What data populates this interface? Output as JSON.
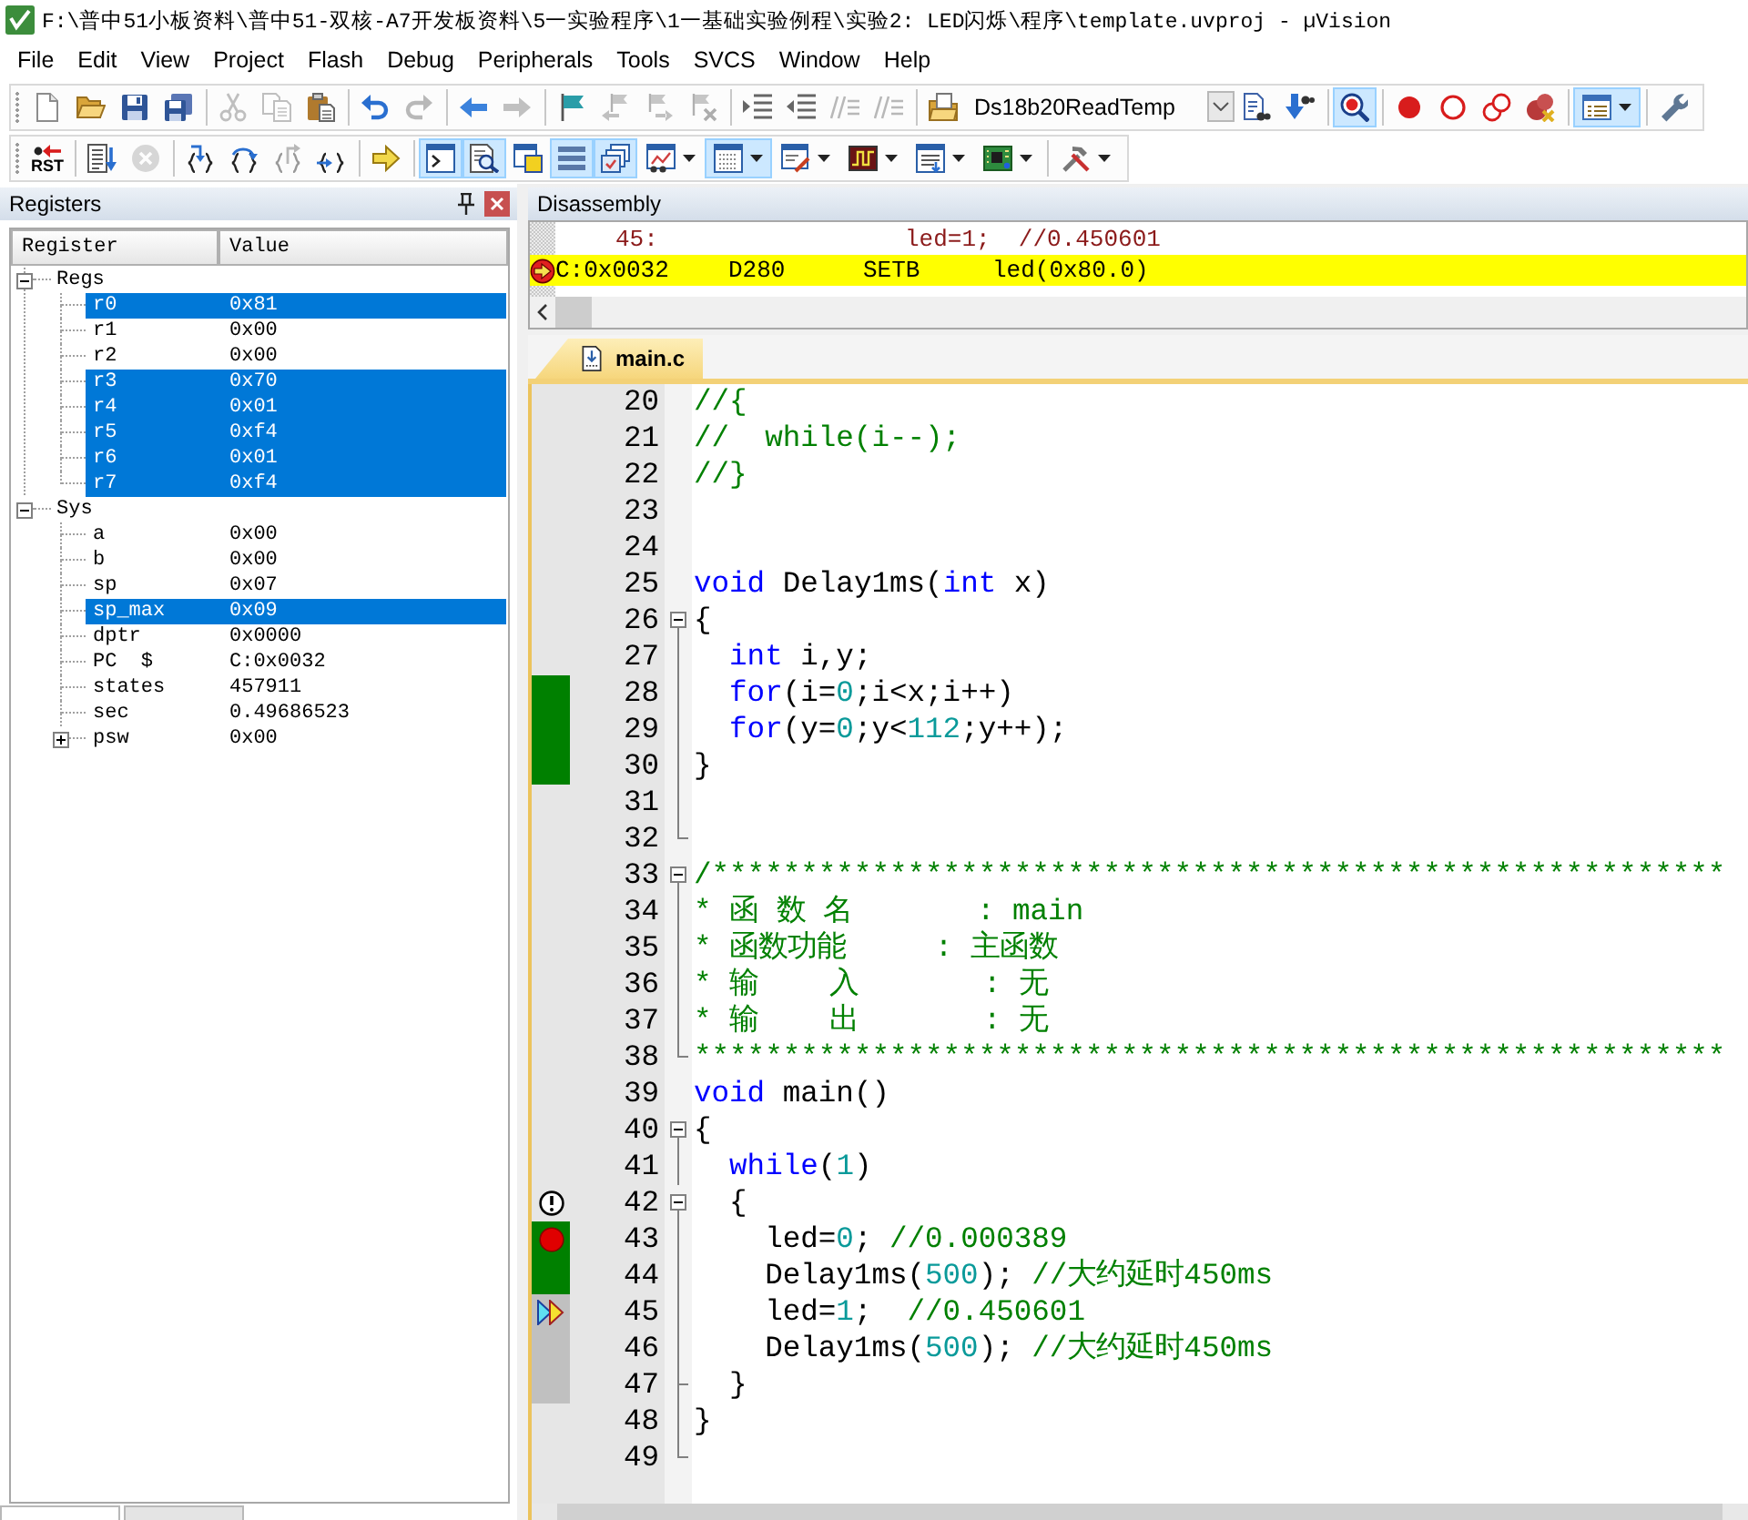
{
  "window": {
    "title": "F:\\普中51小板资料\\普中51-双核-A7开发板资料\\5一实验程序\\1一基础实验例程\\实验2: LED闪烁\\程序\\template.uvproj - µVision"
  },
  "menu": [
    "File",
    "Edit",
    "View",
    "Project",
    "Flash",
    "Debug",
    "Peripherals",
    "Tools",
    "SVCS",
    "Window",
    "Help"
  ],
  "toolbar_1": {
    "buttons": [
      {
        "pressed": false,
        "disabled": false
      },
      {
        "pressed": false,
        "disabled": false
      },
      {
        "pressed": false,
        "disabled": false
      },
      {
        "pressed": false,
        "disabled": false
      },
      {
        "pressed": false,
        "disabled": true
      },
      {
        "pressed": false,
        "disabled": true
      },
      {
        "pressed": false,
        "disabled": false
      },
      {
        "pressed": false,
        "disabled": false
      },
      {
        "pressed": false,
        "disabled": true
      },
      {
        "pressed": false,
        "disabled": false
      },
      {
        "pressed": false,
        "disabled": true
      },
      {
        "pressed": false,
        "disabled": false
      },
      {
        "pressed": false,
        "disabled": true
      },
      {
        "pressed": false,
        "disabled": true
      },
      {
        "pressed": false,
        "disabled": true
      },
      {
        "pressed": false,
        "disabled": false
      },
      {
        "pressed": false,
        "disabled": false
      },
      {
        "pressed": false,
        "disabled": true
      },
      {
        "pressed": false,
        "disabled": true
      },
      {
        "pressed": false,
        "disabled": false
      },
      {
        "pressed": false,
        "disabled": false
      },
      {
        "pressed": false,
        "disabled": false
      },
      {
        "pressed": true,
        "disabled": false
      },
      {
        "pressed": false,
        "disabled": false
      },
      {
        "pressed": false,
        "disabled": false
      },
      {
        "pressed": false,
        "disabled": false
      },
      {
        "pressed": false,
        "disabled": false
      },
      {
        "pressed": true,
        "disabled": false
      },
      {
        "pressed": false,
        "disabled": false
      }
    ],
    "target": {
      "value": "Ds18b20ReadTemp"
    }
  },
  "toolbar_2": {
    "buttons": [
      {
        "label": "RST",
        "pressed": false,
        "disabled": false
      },
      {
        "pressed": false,
        "disabled": false
      },
      {
        "pressed": false,
        "disabled": true
      },
      {
        "pressed": false,
        "disabled": false
      },
      {
        "pressed": false,
        "disabled": false
      },
      {
        "pressed": false,
        "disabled": true
      },
      {
        "pressed": false,
        "disabled": false
      },
      {
        "pressed": false,
        "disabled": false
      },
      {
        "pressed": true,
        "disabled": false
      },
      {
        "pressed": true,
        "disabled": false
      },
      {
        "pressed": false,
        "disabled": false
      },
      {
        "pressed": true,
        "disabled": false
      },
      {
        "pressed": true,
        "disabled": false
      },
      {
        "pressed": false,
        "disabled": false
      },
      {
        "pressed": true,
        "disabled": false
      },
      {
        "pressed": false,
        "disabled": false
      },
      {
        "pressed": false,
        "disabled": false
      },
      {
        "pressed": false,
        "disabled": false
      },
      {
        "pressed": false,
        "disabled": false
      },
      {
        "pressed": false,
        "disabled": false
      }
    ]
  },
  "registers_panel": {
    "title": "Registers",
    "columns": [
      "Register",
      "Value"
    ],
    "tree": [
      {
        "name": "Regs",
        "selected": false,
        "expanded": true,
        "children": [
          {
            "name": "r0",
            "value": "0x81",
            "selected": true
          },
          {
            "name": "r1",
            "value": "0x00",
            "selected": false
          },
          {
            "name": "r2",
            "value": "0x00",
            "selected": false
          },
          {
            "name": "r3",
            "value": "0x70",
            "selected": true
          },
          {
            "name": "r4",
            "value": "0x01",
            "selected": true
          },
          {
            "name": "r5",
            "value": "0xf4",
            "selected": true
          },
          {
            "name": "r6",
            "value": "0x01",
            "selected": true
          },
          {
            "name": "r7",
            "value": "0xf4",
            "selected": true
          }
        ]
      },
      {
        "name": "Sys",
        "selected": false,
        "expanded": true,
        "children": [
          {
            "name": "a",
            "value": "0x00",
            "selected": false
          },
          {
            "name": "b",
            "value": "0x00",
            "selected": false
          },
          {
            "name": "sp",
            "value": "0x07",
            "selected": false
          },
          {
            "name": "sp_max",
            "value": "0x09",
            "selected": true
          },
          {
            "name": "dptr",
            "value": "0x0000",
            "selected": false
          },
          {
            "name": "PC  $",
            "value": "C:0x0032",
            "selected": false
          },
          {
            "name": "states",
            "value": "457911",
            "selected": false
          },
          {
            "name": "sec",
            "value": "0.49686523",
            "selected": false
          },
          {
            "name": "psw",
            "value": "0x00",
            "selected": false,
            "expanded": false
          }
        ]
      }
    ],
    "tabs": [
      {
        "selected": true
      },
      {
        "selected": false
      }
    ]
  },
  "disassembly_panel": {
    "title": "Disassembly",
    "lines": [
      {
        "kind": "source",
        "line": "45:",
        "code": "led=1;  //0.450601",
        "current": false
      },
      {
        "kind": "instruction",
        "address": "C:0x0032",
        "opcode": "D280",
        "mnemonic": "SETB",
        "operand": "led(0x80.0)",
        "current": true
      }
    ]
  },
  "editor": {
    "tabs": [
      {
        "label": "main.c",
        "selected": true
      }
    ],
    "lines": [
      {
        "number": "20",
        "tokens": [
          {
            "kind": "comment",
            "text": "//{"
          }
        ]
      },
      {
        "number": "21",
        "tokens": [
          {
            "kind": "comment",
            "text": "//  while(i--);"
          }
        ]
      },
      {
        "number": "22",
        "tokens": [
          {
            "kind": "comment",
            "text": "//}"
          }
        ]
      },
      {
        "number": "23"
      },
      {
        "number": "24"
      },
      {
        "number": "25",
        "tokens": [
          {
            "kind": "keyword",
            "text": "void"
          },
          {
            "kind": "plain",
            "text": " Delay1ms("
          },
          {
            "kind": "keyword",
            "text": "int"
          },
          {
            "kind": "plain",
            "text": " x)"
          }
        ]
      },
      {
        "number": "26",
        "fold": {
          "kind": "start",
          "expanded": true
        },
        "tokens": [
          {
            "kind": "plain",
            "text": "{"
          }
        ]
      },
      {
        "number": "27",
        "fold": {
          "kind": "line"
        },
        "tokens": [
          {
            "kind": "keyword",
            "text": "  int"
          },
          {
            "kind": "plain",
            "text": " i,y;"
          }
        ]
      },
      {
        "number": "28",
        "fold": {
          "kind": "line"
        },
        "executed": true,
        "tokens": [
          {
            "kind": "keyword",
            "text": "  for"
          },
          {
            "kind": "plain",
            "text": "(i="
          },
          {
            "kind": "number",
            "text": "0"
          },
          {
            "kind": "plain",
            "text": ";i<x;i++)"
          }
        ]
      },
      {
        "number": "29",
        "fold": {
          "kind": "line"
        },
        "executed": true,
        "tokens": [
          {
            "kind": "keyword",
            "text": "  for"
          },
          {
            "kind": "plain",
            "text": "(y="
          },
          {
            "kind": "number",
            "text": "0"
          },
          {
            "kind": "plain",
            "text": ";y<"
          },
          {
            "kind": "number",
            "text": "112"
          },
          {
            "kind": "plain",
            "text": ";y++);"
          }
        ]
      },
      {
        "number": "30",
        "fold": {
          "kind": "line"
        },
        "executed": true,
        "tokens": [
          {
            "kind": "plain",
            "text": "}"
          }
        ]
      },
      {
        "number": "31",
        "fold": {
          "kind": "line"
        }
      },
      {
        "number": "32",
        "fold": {
          "kind": "end"
        }
      },
      {
        "number": "33",
        "fold": {
          "kind": "start",
          "expanded": true
        },
        "tokens": [
          {
            "kind": "comment",
            "text": "/*********************************************************"
          }
        ]
      },
      {
        "number": "34",
        "fold": {
          "kind": "line"
        },
        "tokens": [
          {
            "kind": "comment",
            "text": "* 函 数 名       : main"
          }
        ]
      },
      {
        "number": "35",
        "fold": {
          "kind": "line"
        },
        "tokens": [
          {
            "kind": "comment",
            "text": "* 函数功能     : 主函数"
          }
        ]
      },
      {
        "number": "36",
        "fold": {
          "kind": "line"
        },
        "tokens": [
          {
            "kind": "comment",
            "text": "* 输    入       : 无"
          }
        ]
      },
      {
        "number": "37",
        "fold": {
          "kind": "line"
        },
        "tokens": [
          {
            "kind": "comment",
            "text": "* 输    出       : 无"
          }
        ]
      },
      {
        "number": "38",
        "fold": {
          "kind": "end"
        },
        "tokens": [
          {
            "kind": "comment",
            "text": "**********************************************************"
          }
        ]
      },
      {
        "number": "39",
        "tokens": [
          {
            "kind": "keyword",
            "text": "void"
          },
          {
            "kind": "plain",
            "text": " main()"
          }
        ]
      },
      {
        "number": "40",
        "fold": {
          "kind": "start",
          "expanded": true
        },
        "tokens": [
          {
            "kind": "plain",
            "text": "{"
          }
        ]
      },
      {
        "number": "41",
        "fold": {
          "kind": "line"
        },
        "tokens": [
          {
            "kind": "keyword",
            "text": "  while"
          },
          {
            "kind": "plain",
            "text": "("
          },
          {
            "kind": "number",
            "text": "1"
          },
          {
            "kind": "plain",
            "text": ")"
          }
        ]
      },
      {
        "number": "42",
        "fold": {
          "kind": "start",
          "expanded": true
        },
        "warning": true,
        "tokens": [
          {
            "kind": "plain",
            "text": "  {"
          }
        ]
      },
      {
        "number": "43",
        "fold": {
          "kind": "line"
        },
        "executed": true,
        "breakpoint": true,
        "tokens": [
          {
            "kind": "plain",
            "text": "    led="
          },
          {
            "kind": "number",
            "text": "0"
          },
          {
            "kind": "plain",
            "text": "; "
          },
          {
            "kind": "comment",
            "text": "//0.000389"
          }
        ]
      },
      {
        "number": "44",
        "fold": {
          "kind": "line"
        },
        "executed": true,
        "tokens": [
          {
            "kind": "plain",
            "text": "    Delay1ms("
          },
          {
            "kind": "number",
            "text": "500"
          },
          {
            "kind": "plain",
            "text": "); "
          },
          {
            "kind": "comment",
            "text": "//大约延时450ms"
          }
        ]
      },
      {
        "number": "45",
        "fold": {
          "kind": "line"
        },
        "executed": false,
        "current": true,
        "tokens": [
          {
            "kind": "plain",
            "text": "    led="
          },
          {
            "kind": "number",
            "text": "1"
          },
          {
            "kind": "plain",
            "text": ";  "
          },
          {
            "kind": "comment",
            "text": "//0.450601"
          }
        ]
      },
      {
        "number": "46",
        "fold": {
          "kind": "line"
        },
        "executed": false,
        "tokens": [
          {
            "kind": "plain",
            "text": "    Delay1ms("
          },
          {
            "kind": "number",
            "text": "500"
          },
          {
            "kind": "plain",
            "text": "); "
          },
          {
            "kind": "comment",
            "text": "//大约延时450ms"
          }
        ]
      },
      {
        "number": "47",
        "fold": {
          "kind": "branch_end"
        },
        "executed": false,
        "tokens": [
          {
            "kind": "plain",
            "text": "  }"
          }
        ]
      },
      {
        "number": "48",
        "fold": {
          "kind": "line"
        },
        "tokens": [
          {
            "kind": "plain",
            "text": "}"
          }
        ]
      },
      {
        "number": "49",
        "fold": {
          "kind": "end"
        }
      }
    ]
  }
}
